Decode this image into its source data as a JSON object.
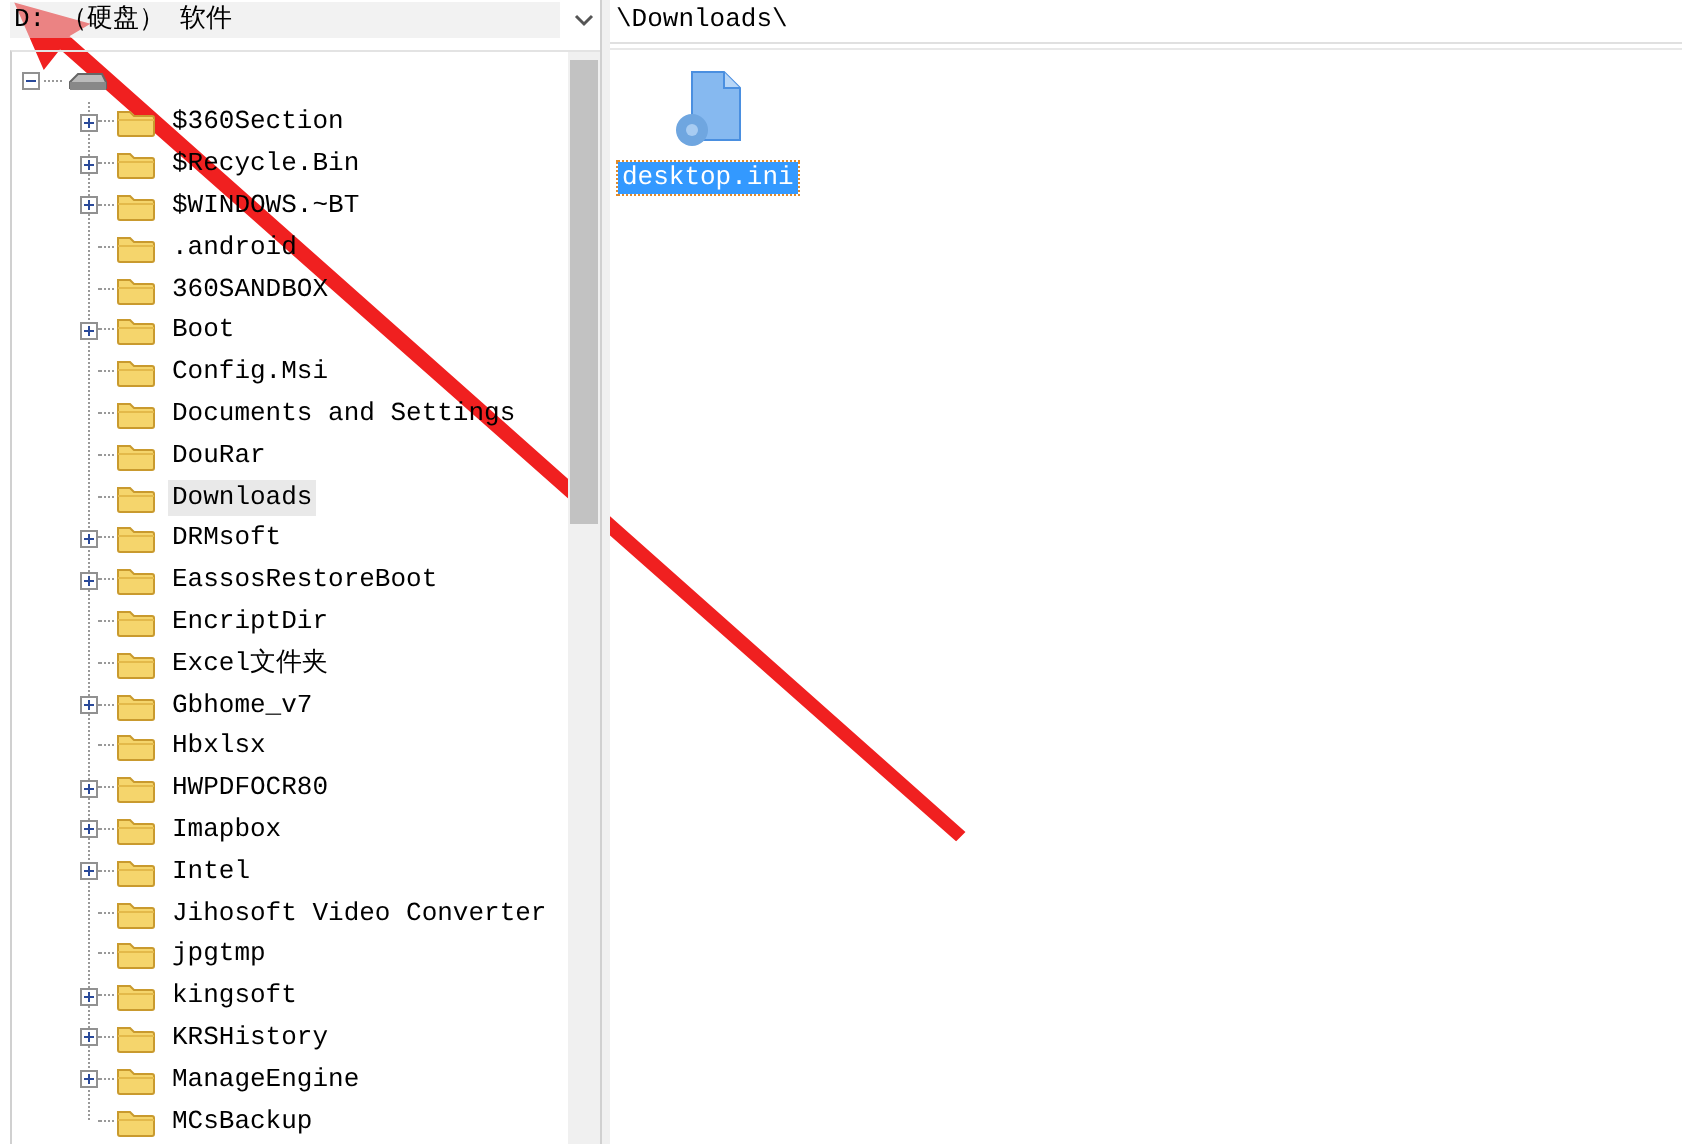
{
  "drive_selector": {
    "value": "D: （硬盘） 软件"
  },
  "path": "\\Downloads\\",
  "tree": {
    "expanded": true,
    "children": [
      {
        "name": "$360Section",
        "expandable": true,
        "selected": false
      },
      {
        "name": "$Recycle.Bin",
        "expandable": true,
        "selected": false
      },
      {
        "name": "$WINDOWS.~BT",
        "expandable": true,
        "selected": false
      },
      {
        "name": ".android",
        "expandable": false,
        "selected": false
      },
      {
        "name": "360SANDBOX",
        "expandable": false,
        "selected": false
      },
      {
        "name": "Boot",
        "expandable": true,
        "selected": false
      },
      {
        "name": "Config.Msi",
        "expandable": false,
        "selected": false
      },
      {
        "name": "Documents and Settings",
        "expandable": false,
        "selected": false
      },
      {
        "name": "DouRar",
        "expandable": false,
        "selected": false
      },
      {
        "name": "Downloads",
        "expandable": false,
        "selected": true
      },
      {
        "name": "DRMsoft",
        "expandable": true,
        "selected": false
      },
      {
        "name": "EassosRestoreBoot",
        "expandable": true,
        "selected": false
      },
      {
        "name": "EncriptDir",
        "expandable": false,
        "selected": false
      },
      {
        "name": "Excel文件夹",
        "expandable": false,
        "selected": false
      },
      {
        "name": "Gbhome_v7",
        "expandable": true,
        "selected": false
      },
      {
        "name": "Hbxlsx",
        "expandable": false,
        "selected": false
      },
      {
        "name": "HWPDFOCR80",
        "expandable": true,
        "selected": false
      },
      {
        "name": "Imapbox",
        "expandable": true,
        "selected": false
      },
      {
        "name": "Intel",
        "expandable": true,
        "selected": false
      },
      {
        "name": "Jihosoft Video Converter",
        "expandable": false,
        "selected": false
      },
      {
        "name": "jpgtmp",
        "expandable": false,
        "selected": false
      },
      {
        "name": "kingsoft",
        "expandable": true,
        "selected": false
      },
      {
        "name": "KRSHistory",
        "expandable": true,
        "selected": false
      },
      {
        "name": "ManageEngine",
        "expandable": true,
        "selected": false
      },
      {
        "name": "MCsBackup",
        "expandable": false,
        "selected": false
      }
    ]
  },
  "files": [
    {
      "name": "desktop.ini",
      "selected": true
    }
  ]
}
